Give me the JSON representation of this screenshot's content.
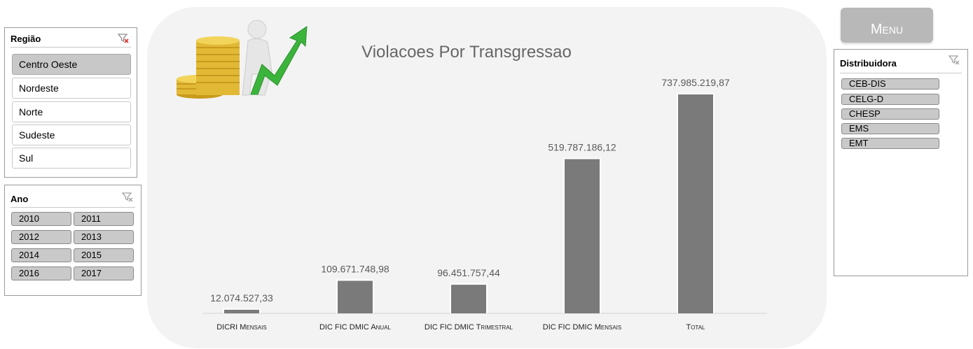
{
  "regiao": {
    "title": "Região",
    "items": [
      {
        "label": "Centro Oeste",
        "selected": true
      },
      {
        "label": "Nordeste",
        "selected": false
      },
      {
        "label": "Norte",
        "selected": false
      },
      {
        "label": "Sudeste",
        "selected": false
      },
      {
        "label": "Sul",
        "selected": false
      }
    ]
  },
  "ano": {
    "title": "Ano",
    "items": [
      "2010",
      "2011",
      "2012",
      "2013",
      "2014",
      "2015",
      "2016",
      "2017"
    ]
  },
  "distribuidora": {
    "title": "Distribuidora",
    "items": [
      "CEB-DIS",
      "CELG-D",
      "CHESP",
      "EMS",
      "EMT"
    ]
  },
  "menu": {
    "label": "Menu"
  },
  "colors": {
    "bar": "#7a7a7a",
    "chart_background": "#f3f3f3",
    "title": "#666666",
    "label": "#595959"
  },
  "chart_data": {
    "type": "bar",
    "title": "Violacoes Por Transgressao",
    "categories": [
      "DICRI Mensais",
      "DIC FIC DMIC Anual",
      "DIC FIC DMIC Trimestral",
      "DIC FIC DMIC Mensais",
      "Total"
    ],
    "values": [
      12074527.33,
      109671748.98,
      96451757.44,
      519787186.12,
      737985219.87
    ],
    "data_labels": [
      "12.074.527,33",
      "109.671.748,98",
      "96.451.757,44",
      "519.787.186,12",
      "737.985.219,87"
    ],
    "xlabel": "",
    "ylabel": "",
    "ylim": [
      0,
      737985219.87
    ],
    "grid": false,
    "legend": "none"
  }
}
